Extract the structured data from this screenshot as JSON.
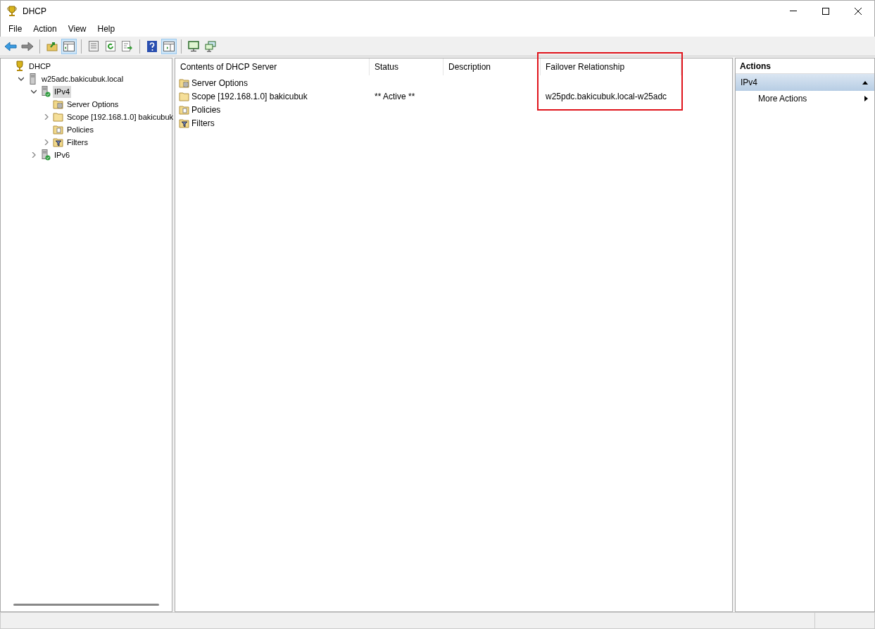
{
  "window": {
    "title": "DHCP"
  },
  "menu": [
    "File",
    "Action",
    "View",
    "Help"
  ],
  "tree": [
    {
      "label": "DHCP",
      "kind": "root",
      "selected": false,
      "children": [
        {
          "label": "w25adc.bakicubuk.local",
          "kind": "server",
          "expanded": true,
          "selected": false,
          "children": [
            {
              "label": "IPv4",
              "kind": "protocol",
              "expanded": true,
              "selected": true,
              "children": [
                {
                  "label": "Server Options",
                  "kind": "options",
                  "selected": false
                },
                {
                  "label": "Scope [192.168.1.0] bakicubuk",
                  "kind": "scope",
                  "expanded": false,
                  "selected": false
                },
                {
                  "label": "Policies",
                  "kind": "policies",
                  "selected": false
                },
                {
                  "label": "Filters",
                  "kind": "filters",
                  "expanded": false,
                  "selected": false
                }
              ]
            },
            {
              "label": "IPv6",
              "kind": "protocol",
              "expanded": false,
              "selected": false
            }
          ]
        }
      ]
    }
  ],
  "list": {
    "columns": [
      {
        "label": "Contents of DHCP Server",
        "highlighted": false
      },
      {
        "label": "Status",
        "highlighted": false
      },
      {
        "label": "Description",
        "highlighted": false
      },
      {
        "label": "Failover Relationship",
        "highlighted": true
      }
    ],
    "rows": [
      {
        "kind": "options",
        "cells": [
          "Server Options",
          "",
          "",
          ""
        ]
      },
      {
        "kind": "scope",
        "cells": [
          "Scope [192.168.1.0] bakicubuk",
          "** Active **",
          "",
          "w25pdc.bakicubuk.local-w25adc"
        ]
      },
      {
        "kind": "policies",
        "cells": [
          "Policies",
          "",
          "",
          ""
        ]
      },
      {
        "kind": "filters",
        "cells": [
          "Filters",
          "",
          "",
          ""
        ]
      }
    ]
  },
  "actions": {
    "title": "Actions",
    "section": "IPv4",
    "items": [
      "More Actions"
    ]
  }
}
